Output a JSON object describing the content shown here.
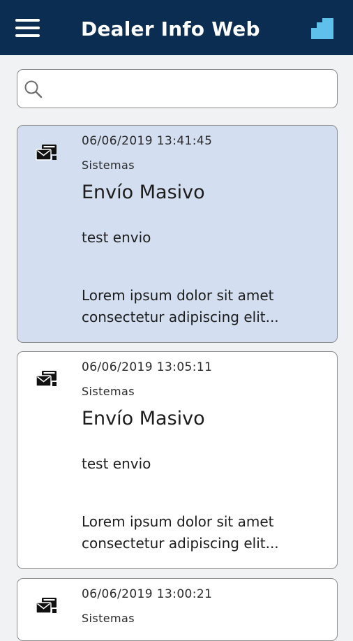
{
  "app_bar": {
    "title": "Dealer Info Web",
    "menu_icon": "hamburger-menu-icon",
    "logo_icon": "app-logo-icon",
    "background_color": "#0c2d52",
    "logo_color": "#5fc0ec"
  },
  "search": {
    "value": "",
    "placeholder": "",
    "icon": "search-icon"
  },
  "messages": [
    {
      "date": "06/06/2019 13:41:45",
      "sender": "Sistemas",
      "title": "Envío Masivo",
      "subject": "test envio",
      "body_line1": "Lorem ipsum dolor sit amet",
      "body_line2": "consectetur adipiscing elit...",
      "selected": true,
      "icon": "mail-envelopes-icon"
    },
    {
      "date": "06/06/2019 13:05:11",
      "sender": "Sistemas",
      "title": "Envío Masivo",
      "subject": "test envio",
      "body_line1": "Lorem ipsum dolor sit amet",
      "body_line2": "consectetur adipiscing elit...",
      "selected": false,
      "icon": "mail-envelopes-icon"
    },
    {
      "date": "06/06/2019 13:00:21",
      "sender": "Sistemas",
      "title": "",
      "subject": "",
      "body_line1": "",
      "body_line2": "",
      "selected": false,
      "icon": "mail-envelopes-icon"
    }
  ],
  "colors": {
    "selected_card": "#d3dff0",
    "card": "#ffffff",
    "page_background": "#f1f2f3"
  }
}
